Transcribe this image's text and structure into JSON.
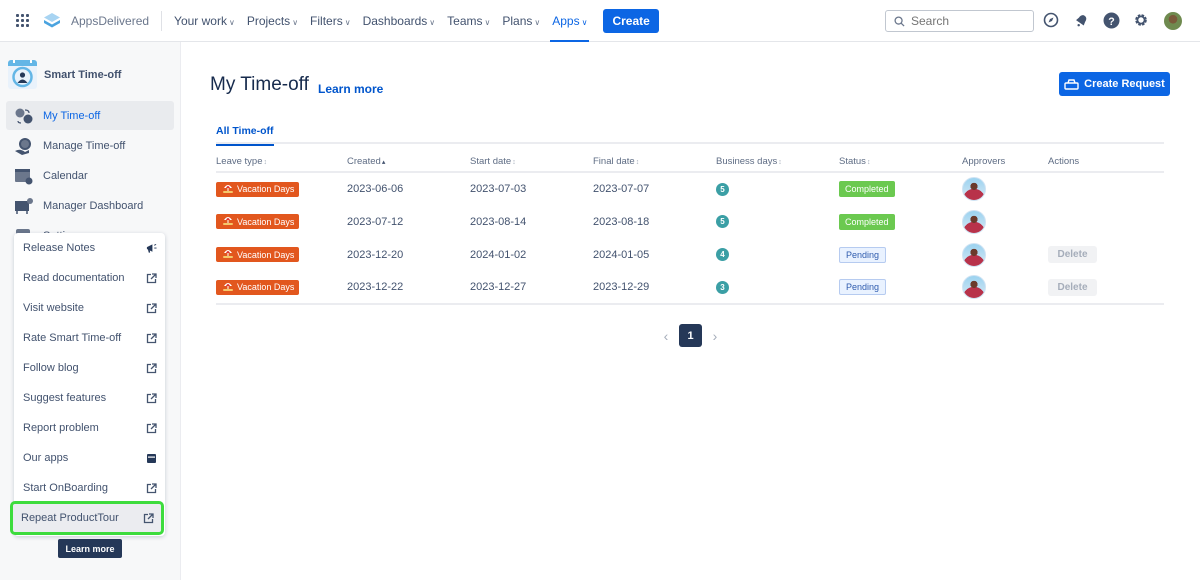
{
  "topnav": {
    "brand": "AppsDelivered",
    "items": [
      {
        "label": "Your work",
        "active": false
      },
      {
        "label": "Projects",
        "active": false
      },
      {
        "label": "Filters",
        "active": false
      },
      {
        "label": "Dashboards",
        "active": false
      },
      {
        "label": "Teams",
        "active": false
      },
      {
        "label": "Plans",
        "active": false
      },
      {
        "label": "Apps",
        "active": true
      }
    ],
    "create_label": "Create",
    "search_placeholder": "Search",
    "icons": [
      "explore-icon",
      "notifications-icon",
      "help-icon",
      "settings-icon",
      "profile-avatar"
    ]
  },
  "sidebar": {
    "app_title": "Smart Time-off",
    "items": [
      {
        "label": "My Time-off",
        "active": true,
        "icon": "my-time-off-icon"
      },
      {
        "label": "Manage Time-off",
        "active": false,
        "icon": "manage-time-off-icon"
      },
      {
        "label": "Calendar",
        "active": false,
        "icon": "calendar-icon"
      },
      {
        "label": "Manager Dashboard",
        "active": false,
        "icon": "manager-dashboard-icon"
      },
      {
        "label": "Settings",
        "active": false,
        "icon": "settings-icon"
      }
    ]
  },
  "popup_menu": {
    "items": [
      {
        "label": "Release Notes",
        "icon": "megaphone-icon"
      },
      {
        "label": "Read documentation",
        "icon": "external-link-icon"
      },
      {
        "label": "Visit website",
        "icon": "external-link-icon"
      },
      {
        "label": "Rate Smart Time-off",
        "icon": "external-link-icon"
      },
      {
        "label": "Follow blog",
        "icon": "external-link-icon"
      },
      {
        "label": "Suggest features",
        "icon": "external-link-icon"
      },
      {
        "label": "Report problem",
        "icon": "external-link-icon"
      },
      {
        "label": "Our apps",
        "icon": "store-icon"
      },
      {
        "label": "Start OnBoarding",
        "icon": "external-link-icon"
      },
      {
        "label": "Repeat ProductTour",
        "icon": "external-link-icon",
        "highlighted": true
      }
    ],
    "learn_more_label": "Learn more",
    "highlight_color": "#3ddc3d"
  },
  "main": {
    "title": "My Time-off",
    "learn_more_link": "Learn more",
    "create_request_label": "Create Request",
    "tabs": [
      {
        "label": "All Time-off",
        "active": true
      }
    ],
    "table": {
      "columns": [
        {
          "label": "Leave type",
          "sortable": true,
          "sort": "none"
        },
        {
          "label": "Created",
          "sortable": true,
          "sort": "asc"
        },
        {
          "label": "Start date",
          "sortable": true,
          "sort": "none"
        },
        {
          "label": "Final date",
          "sortable": true,
          "sort": "none"
        },
        {
          "label": "Business days",
          "sortable": true,
          "sort": "none"
        },
        {
          "label": "Status",
          "sortable": true,
          "sort": "none"
        },
        {
          "label": "Approvers",
          "sortable": false
        },
        {
          "label": "Actions",
          "sortable": false
        }
      ],
      "rows": [
        {
          "leave_type": "Vacation Days",
          "created": "2023-06-06",
          "start": "2023-07-03",
          "final": "2023-07-07",
          "days": "5",
          "status": "Completed",
          "action": ""
        },
        {
          "leave_type": "Vacation Days",
          "created": "2023-07-12",
          "start": "2023-08-14",
          "final": "2023-08-18",
          "days": "5",
          "status": "Completed",
          "action": ""
        },
        {
          "leave_type": "Vacation Days",
          "created": "2023-12-20",
          "start": "2024-01-02",
          "final": "2024-01-05",
          "days": "4",
          "status": "Pending",
          "action": "Delete"
        },
        {
          "leave_type": "Vacation Days",
          "created": "2023-12-22",
          "start": "2023-12-27",
          "final": "2023-12-29",
          "days": "3",
          "status": "Pending",
          "action": "Delete"
        }
      ]
    },
    "pagination": {
      "current_page": "1",
      "prev": "‹",
      "next": "›"
    }
  },
  "colors": {
    "primary": "#0c66e4",
    "leave_badge": "#e2571e",
    "completed": "#6bc950",
    "pending_bg": "#e9f2ff",
    "days_badge": "#3b9fa5",
    "pager_active": "#253858"
  }
}
